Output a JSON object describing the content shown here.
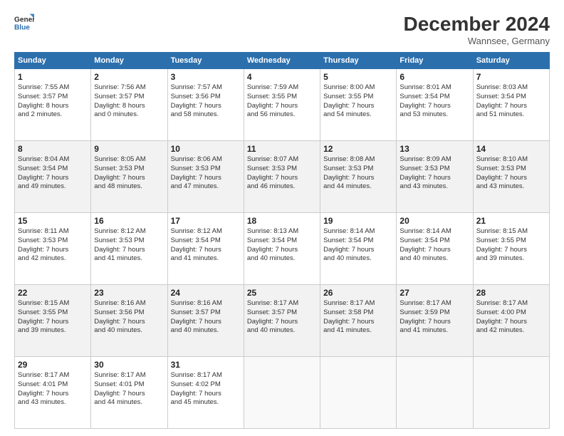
{
  "logo": {
    "line1": "General",
    "line2": "Blue"
  },
  "title": "December 2024",
  "location": "Wannsee, Germany",
  "days_header": [
    "Sunday",
    "Monday",
    "Tuesday",
    "Wednesday",
    "Thursday",
    "Friday",
    "Saturday"
  ],
  "weeks": [
    [
      {
        "num": "1",
        "info": "Sunrise: 7:55 AM\nSunset: 3:57 PM\nDaylight: 8 hours\nand 2 minutes."
      },
      {
        "num": "2",
        "info": "Sunrise: 7:56 AM\nSunset: 3:57 PM\nDaylight: 8 hours\nand 0 minutes."
      },
      {
        "num": "3",
        "info": "Sunrise: 7:57 AM\nSunset: 3:56 PM\nDaylight: 7 hours\nand 58 minutes."
      },
      {
        "num": "4",
        "info": "Sunrise: 7:59 AM\nSunset: 3:55 PM\nDaylight: 7 hours\nand 56 minutes."
      },
      {
        "num": "5",
        "info": "Sunrise: 8:00 AM\nSunset: 3:55 PM\nDaylight: 7 hours\nand 54 minutes."
      },
      {
        "num": "6",
        "info": "Sunrise: 8:01 AM\nSunset: 3:54 PM\nDaylight: 7 hours\nand 53 minutes."
      },
      {
        "num": "7",
        "info": "Sunrise: 8:03 AM\nSunset: 3:54 PM\nDaylight: 7 hours\nand 51 minutes."
      }
    ],
    [
      {
        "num": "8",
        "info": "Sunrise: 8:04 AM\nSunset: 3:54 PM\nDaylight: 7 hours\nand 49 minutes."
      },
      {
        "num": "9",
        "info": "Sunrise: 8:05 AM\nSunset: 3:53 PM\nDaylight: 7 hours\nand 48 minutes."
      },
      {
        "num": "10",
        "info": "Sunrise: 8:06 AM\nSunset: 3:53 PM\nDaylight: 7 hours\nand 47 minutes."
      },
      {
        "num": "11",
        "info": "Sunrise: 8:07 AM\nSunset: 3:53 PM\nDaylight: 7 hours\nand 46 minutes."
      },
      {
        "num": "12",
        "info": "Sunrise: 8:08 AM\nSunset: 3:53 PM\nDaylight: 7 hours\nand 44 minutes."
      },
      {
        "num": "13",
        "info": "Sunrise: 8:09 AM\nSunset: 3:53 PM\nDaylight: 7 hours\nand 43 minutes."
      },
      {
        "num": "14",
        "info": "Sunrise: 8:10 AM\nSunset: 3:53 PM\nDaylight: 7 hours\nand 43 minutes."
      }
    ],
    [
      {
        "num": "15",
        "info": "Sunrise: 8:11 AM\nSunset: 3:53 PM\nDaylight: 7 hours\nand 42 minutes."
      },
      {
        "num": "16",
        "info": "Sunrise: 8:12 AM\nSunset: 3:53 PM\nDaylight: 7 hours\nand 41 minutes."
      },
      {
        "num": "17",
        "info": "Sunrise: 8:12 AM\nSunset: 3:54 PM\nDaylight: 7 hours\nand 41 minutes."
      },
      {
        "num": "18",
        "info": "Sunrise: 8:13 AM\nSunset: 3:54 PM\nDaylight: 7 hours\nand 40 minutes."
      },
      {
        "num": "19",
        "info": "Sunrise: 8:14 AM\nSunset: 3:54 PM\nDaylight: 7 hours\nand 40 minutes."
      },
      {
        "num": "20",
        "info": "Sunrise: 8:14 AM\nSunset: 3:54 PM\nDaylight: 7 hours\nand 40 minutes."
      },
      {
        "num": "21",
        "info": "Sunrise: 8:15 AM\nSunset: 3:55 PM\nDaylight: 7 hours\nand 39 minutes."
      }
    ],
    [
      {
        "num": "22",
        "info": "Sunrise: 8:15 AM\nSunset: 3:55 PM\nDaylight: 7 hours\nand 39 minutes."
      },
      {
        "num": "23",
        "info": "Sunrise: 8:16 AM\nSunset: 3:56 PM\nDaylight: 7 hours\nand 40 minutes."
      },
      {
        "num": "24",
        "info": "Sunrise: 8:16 AM\nSunset: 3:57 PM\nDaylight: 7 hours\nand 40 minutes."
      },
      {
        "num": "25",
        "info": "Sunrise: 8:17 AM\nSunset: 3:57 PM\nDaylight: 7 hours\nand 40 minutes."
      },
      {
        "num": "26",
        "info": "Sunrise: 8:17 AM\nSunset: 3:58 PM\nDaylight: 7 hours\nand 41 minutes."
      },
      {
        "num": "27",
        "info": "Sunrise: 8:17 AM\nSunset: 3:59 PM\nDaylight: 7 hours\nand 41 minutes."
      },
      {
        "num": "28",
        "info": "Sunrise: 8:17 AM\nSunset: 4:00 PM\nDaylight: 7 hours\nand 42 minutes."
      }
    ],
    [
      {
        "num": "29",
        "info": "Sunrise: 8:17 AM\nSunset: 4:01 PM\nDaylight: 7 hours\nand 43 minutes."
      },
      {
        "num": "30",
        "info": "Sunrise: 8:17 AM\nSunset: 4:01 PM\nDaylight: 7 hours\nand 44 minutes."
      },
      {
        "num": "31",
        "info": "Sunrise: 8:17 AM\nSunset: 4:02 PM\nDaylight: 7 hours\nand 45 minutes."
      },
      null,
      null,
      null,
      null
    ]
  ]
}
